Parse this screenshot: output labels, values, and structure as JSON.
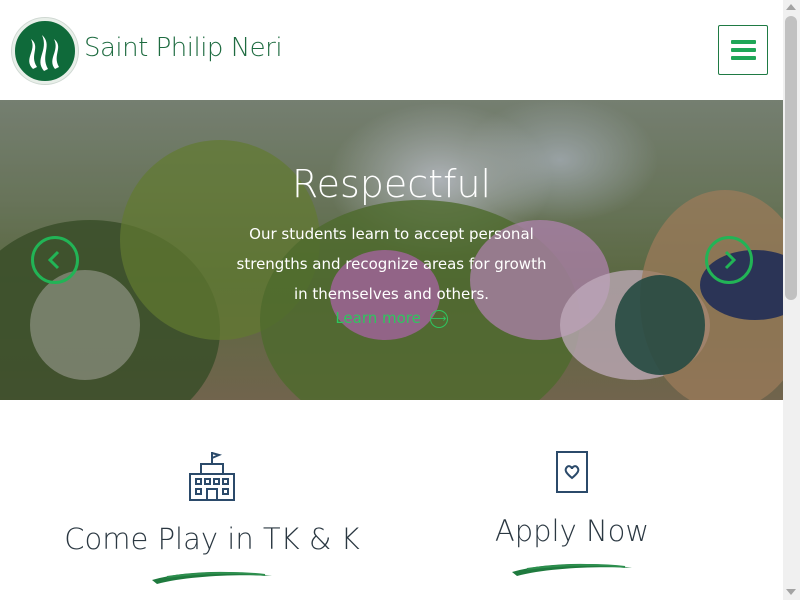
{
  "header": {
    "brand_name": "Saint Philip Neri",
    "menu_icon": "hamburger-menu-icon",
    "logo_icon": "flame-logo-icon"
  },
  "hero": {
    "title": "Respectful",
    "lines": [
      "Our students learn to accept personal",
      "strengths and recognize areas for growth",
      "in themselves and others."
    ],
    "link_label": "Learn more",
    "link_icon": "arrow-circle-icon",
    "prev_icon": "chevron-left-icon",
    "next_icon": "chevron-right-icon"
  },
  "features": [
    {
      "title": "Come Play in TK & K",
      "icon": "school-building-icon"
    },
    {
      "title": "Apply Now",
      "icon": "heart-card-icon"
    }
  ],
  "colors": {
    "brand_green": "#1e6b40",
    "accent_green": "#22b456",
    "text_dark": "#2b3842"
  }
}
